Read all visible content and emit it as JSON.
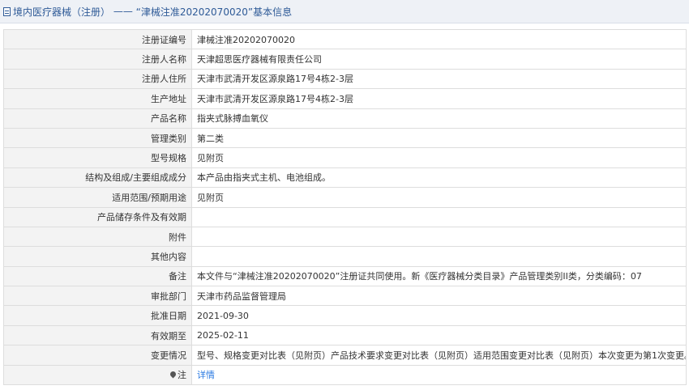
{
  "header": {
    "category": "境内医疗器械（注册）",
    "separator": " —— ",
    "reg_title": "“津械注准20202070020”基本信息"
  },
  "rows": [
    {
      "label": "注册证编号",
      "value": "津械注准20202070020"
    },
    {
      "label": "注册人名称",
      "value": "天津超思医疗器械有限责任公司"
    },
    {
      "label": "注册人住所",
      "value": "天津市武清开发区源泉路17号4栋2-3层"
    },
    {
      "label": "生产地址",
      "value": "天津市武清开发区源泉路17号4栋2-3层"
    },
    {
      "label": "产品名称",
      "value": "指夹式脉搏血氧仪"
    },
    {
      "label": "管理类别",
      "value": "第二类"
    },
    {
      "label": "型号规格",
      "value": "见附页"
    },
    {
      "label": "结构及组成/主要组成成分",
      "value": "本产品由指夹式主机、电池组成。"
    },
    {
      "label": "适用范围/预期用途",
      "value": "见附页"
    },
    {
      "label": "产品储存条件及有效期",
      "value": ""
    },
    {
      "label": "附件",
      "value": ""
    },
    {
      "label": "其他内容",
      "value": ""
    },
    {
      "label": "备注",
      "value": "本文件与“津械注准20202070020”注册证共同使用。新《医疗器械分类目录》产品管理类别II类，分类编码：07"
    },
    {
      "label": "审批部门",
      "value": "天津市药品监督管理局"
    },
    {
      "label": "批准日期",
      "value": "2021-09-30"
    },
    {
      "label": "有效期至",
      "value": "2025-02-11"
    },
    {
      "label": "变更情况",
      "value": "型号、规格变更对比表（见附页）产品技术要求变更对比表（见附页）适用范围变更对比表（见附页）本次变更为第1次变更。"
    }
  ],
  "note": {
    "icon": "pin-icon",
    "label": "注",
    "link_text": "详情"
  }
}
